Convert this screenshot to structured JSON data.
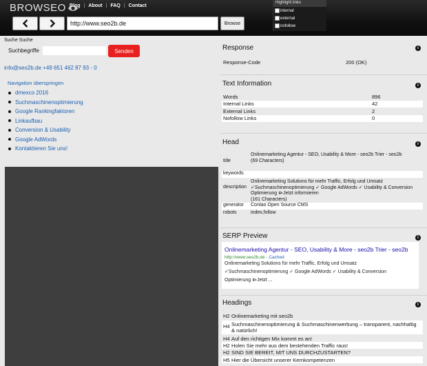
{
  "app": {
    "logo_text": "BROWSEO"
  },
  "top_nav": [
    "Blog",
    "About",
    "FAQ",
    "Contact"
  ],
  "url_bar": {
    "value": "http://www.seo2b.de",
    "browse_label": "Browse"
  },
  "highlight_links": {
    "title": "Highlight links",
    "options": [
      "internal",
      "external",
      "nofollow"
    ]
  },
  "left": {
    "search_heading": "Suche Suche",
    "search_field_label": "Suchbegriffe",
    "send_label": "Senden",
    "contact": "info@seo2b.de +49 651 462 87 93 - 0",
    "skip_nav": "Navigation überspringen",
    "nav_items": [
      "dmexco 2016",
      "Suchmaschinenoptimierung",
      "Google Rankingfaktoren",
      "Linkaufbau",
      "Conversion & Usability",
      "Google AdWords",
      "Kontaktieren Sie uns!"
    ]
  },
  "response": {
    "title": "Response",
    "rows": [
      {
        "key": "Response-Code",
        "value": "200 (OK)"
      }
    ]
  },
  "text_information": {
    "title": "Text Information",
    "rows": [
      {
        "key": "Words",
        "value": "896"
      },
      {
        "key": "Internal Links",
        "value": "42"
      },
      {
        "key": "External Links",
        "value": "2"
      },
      {
        "key": "Nofollow Links",
        "value": "0"
      }
    ]
  },
  "head": {
    "title": "Head",
    "rows": [
      {
        "key": "title",
        "value": "Onlinemarketing Agentur - SEO, Usability & More - seo2b Trier - seo2b",
        "extra": "(69 Characters)"
      },
      {
        "key": "keywords",
        "value": "",
        "extra": ""
      },
      {
        "key": "description",
        "value": "Onlinemarketing Solutions für mehr Traffic, Erfolg und Umsatz ✓Suchmaschinenoptimierung ✓ Google AdWords ✓ Usability & Conversion Optimierung ⧐Jetzt informieren",
        "extra": "(161 Characters)"
      },
      {
        "key": "generator",
        "value": "Contao Open Source CMS",
        "extra": ""
      },
      {
        "key": "robots",
        "value": "index,follow",
        "extra": ""
      }
    ]
  },
  "serp": {
    "title": "SERP Preview",
    "result_title": "Onlinemarketing Agentur - SEO, Usability & More - seo2b Trier - seo2b",
    "result_url": "http://www.seo2b.de",
    "cached": "- Cached",
    "desc_line1": "Onlinemarketing Solutions für mehr Traffic, Erfolg und Umsatz",
    "desc_line2": "✓Suchmaschinenoptimierung ✓ Google AdWords ✓ Usability & Conversion",
    "desc_line3": "Optimierung ⧐Jetzt ..."
  },
  "headings": {
    "title": "Headings",
    "rows": [
      {
        "level": "H2",
        "text": "Onlinemarketing mit seo2b"
      },
      {
        "level": "H4",
        "text": "Suchmaschinenoptimierung & Suchmaschinenwerbung – transparent, nachhaltig & natürlich!"
      },
      {
        "level": "H4",
        "text": "Auf den richtigen Mix kommt es an!"
      },
      {
        "level": "H2",
        "text": "Holen Sie mehr aus dem bestehenden Traffic raus!"
      },
      {
        "level": "H2",
        "text": "SIND SIE BEREIT, MIT UNS DURCHZUSTARTEN?"
      },
      {
        "level": "H5",
        "text": "Hier die Übersicht unserer Kernkompetenzen"
      }
    ]
  },
  "icons": {
    "back": "arrow-left-icon",
    "forward": "arrow-right-icon",
    "info": "info-icon",
    "logo_eye": "eye-icon"
  }
}
